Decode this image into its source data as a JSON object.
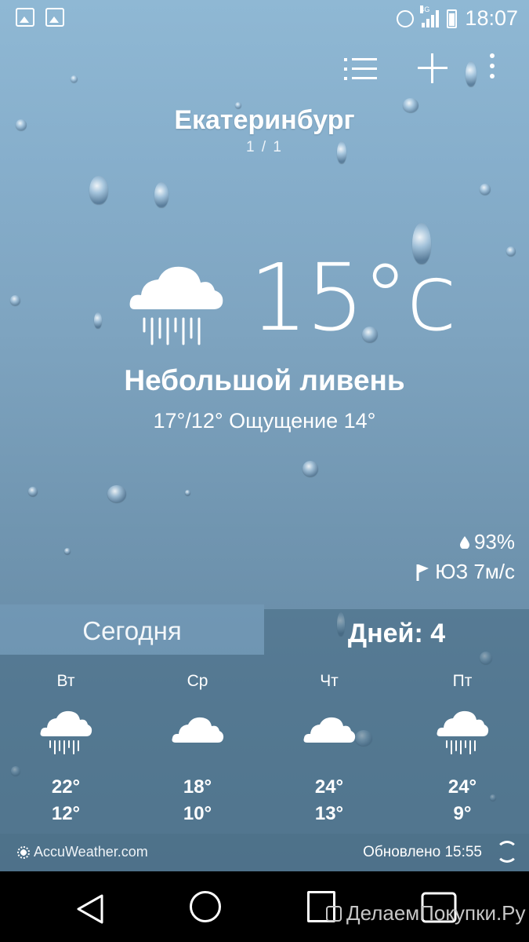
{
  "status_bar": {
    "time": "18:07",
    "network": "4G",
    "icons": [
      "gallery-icon",
      "app-notification-icon",
      "alarm-icon",
      "signal-icon",
      "battery-icon"
    ]
  },
  "toolbar": {
    "icons": [
      "city-list-icon",
      "add-city-icon",
      "more-options-icon"
    ]
  },
  "location": {
    "city": "Екатеринбург",
    "page_indicator": "1 / 1"
  },
  "current": {
    "icon": "rain-shower-icon",
    "temperature": "15°c",
    "condition": "Небольшой ливень",
    "range_feels": "17°/12° Ощущение 14°",
    "humidity": "93%",
    "wind": "ЮЗ 7м/с"
  },
  "tabs": {
    "today": "Сегодня",
    "days": "Дней: 4",
    "active": "days"
  },
  "forecast": [
    {
      "day": "Вт",
      "icon": "rain-shower-icon",
      "high": "22°",
      "low": "12°"
    },
    {
      "day": "Ср",
      "icon": "cloud-icon",
      "high": "18°",
      "low": "10°"
    },
    {
      "day": "Чт",
      "icon": "cloud-icon",
      "high": "24°",
      "low": "13°"
    },
    {
      "day": "Пт",
      "icon": "rain-shower-icon",
      "high": "24°",
      "low": "9°"
    }
  ],
  "footer": {
    "provider": "AccuWeather.com",
    "updated": "Обновлено 15:55"
  },
  "watermark": "ДелаемПокупки.Ру",
  "colors": {
    "sky_top": "#8fb8d4",
    "sky_bottom": "#5e819b",
    "panel": "#46697f",
    "navbar": "#000000"
  }
}
